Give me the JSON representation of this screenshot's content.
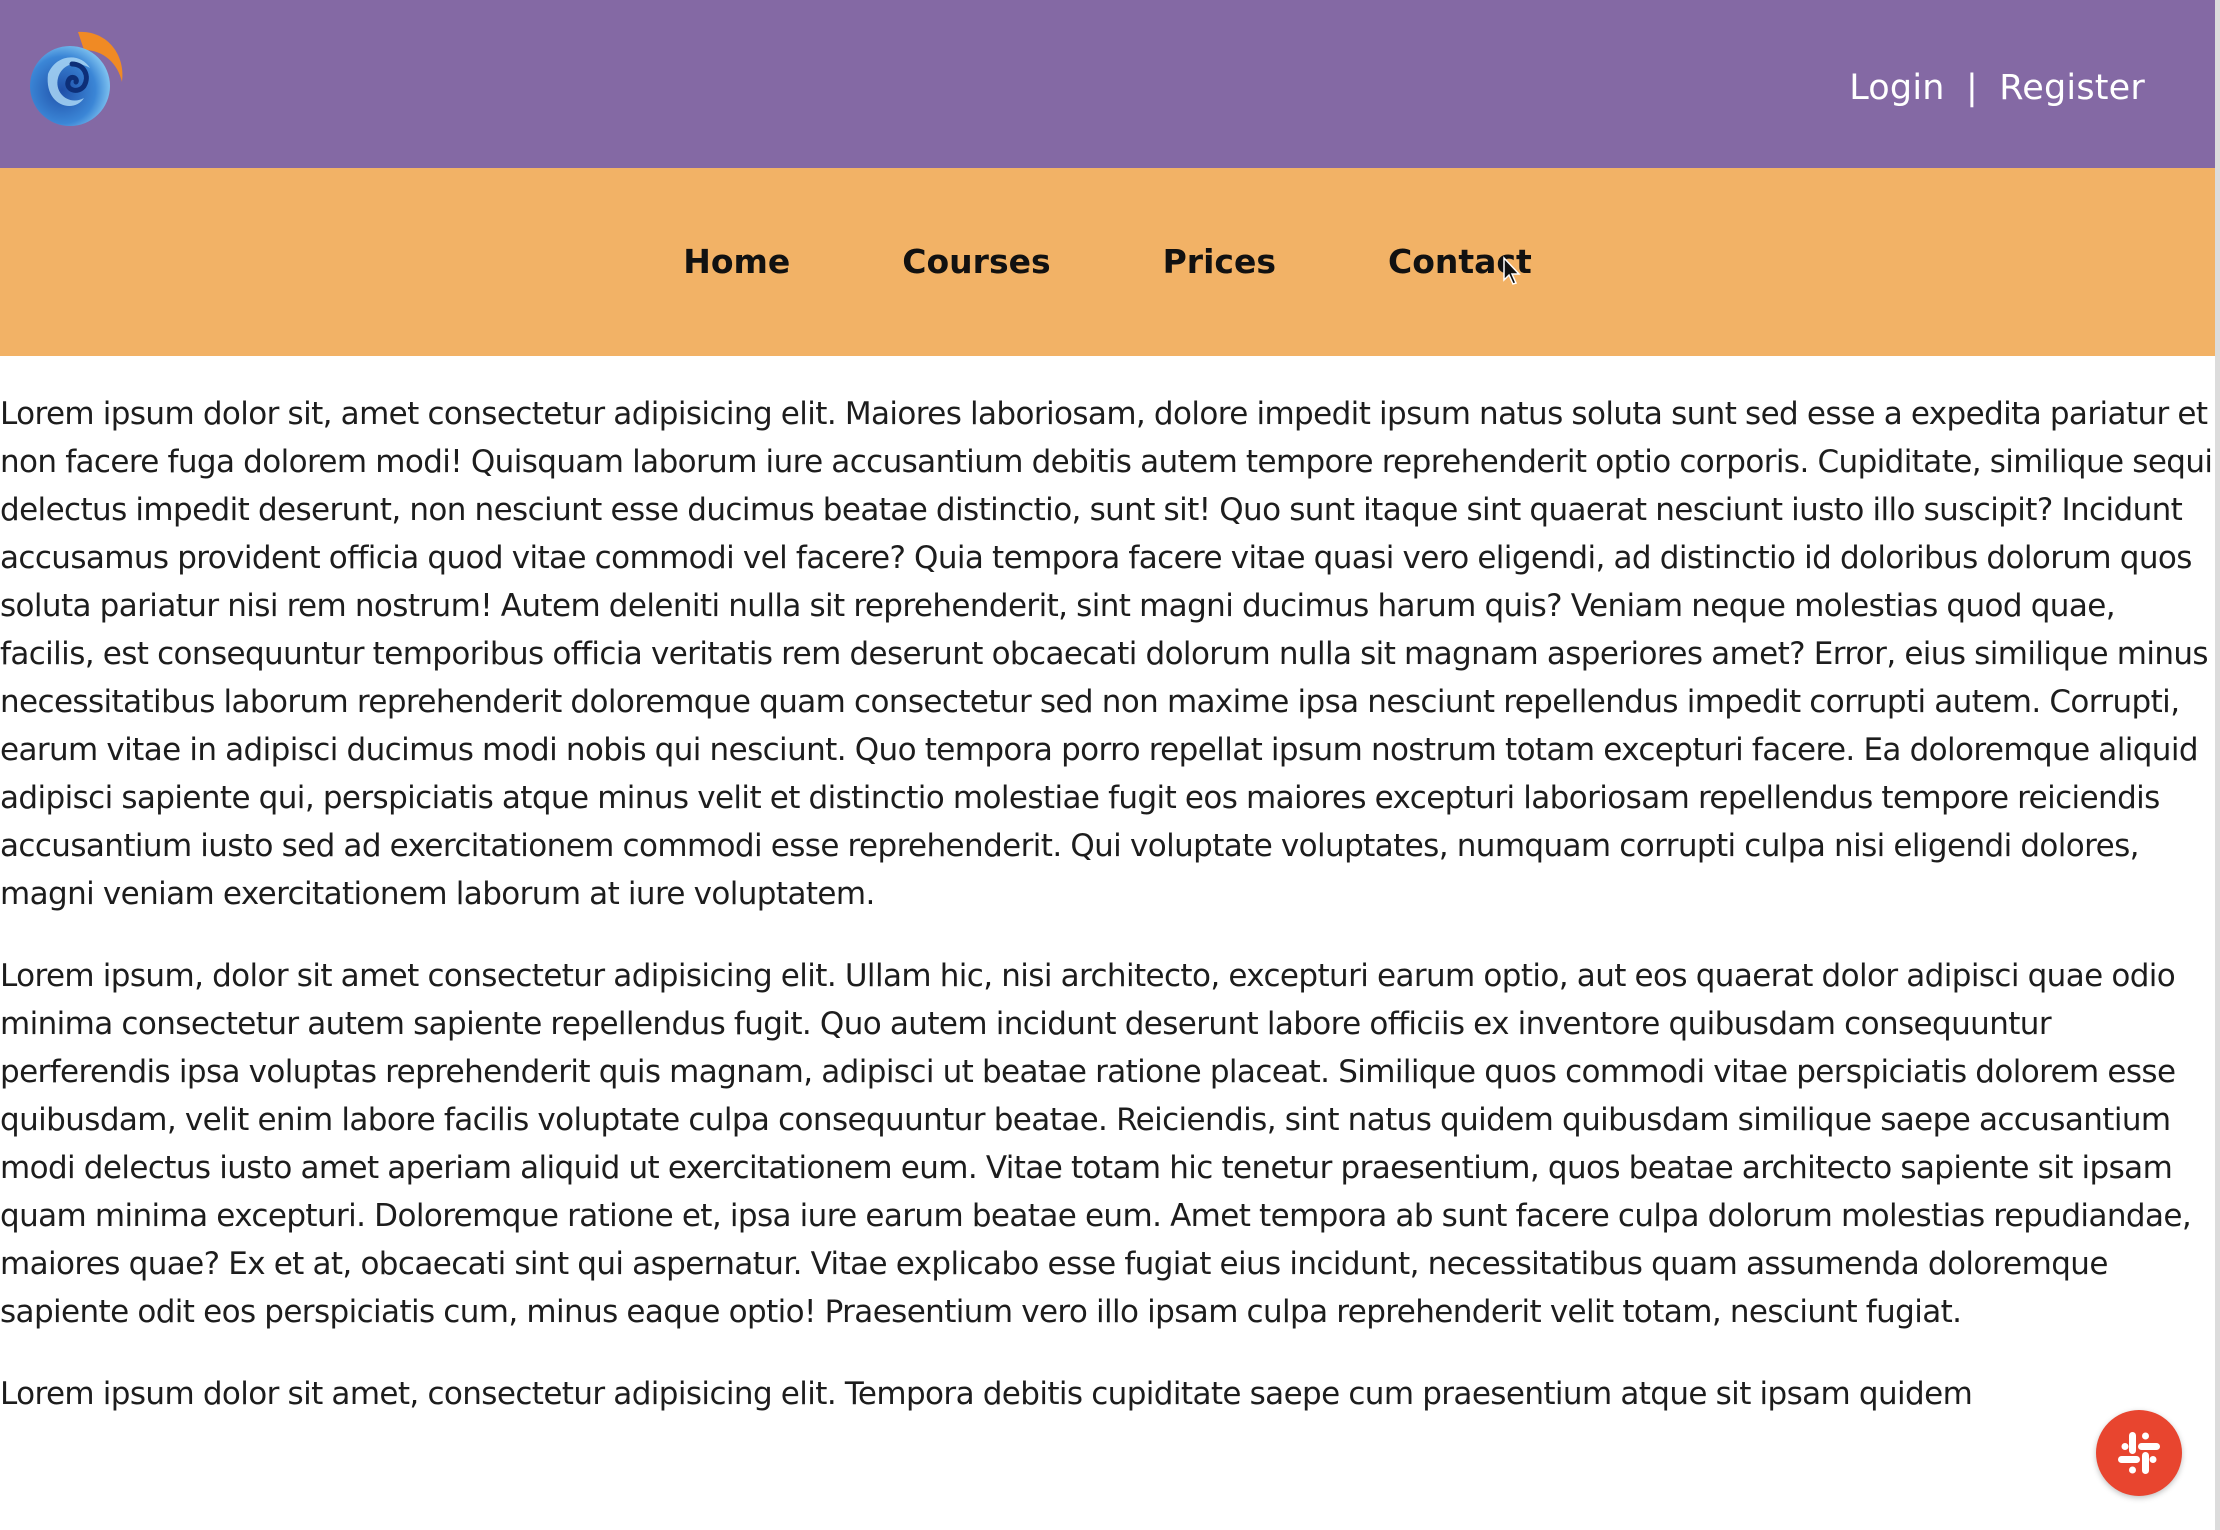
{
  "header": {
    "login_label": "Login",
    "separator": "|",
    "register_label": "Register",
    "logo_icon": "swirl-logo-icon",
    "colors": {
      "top_bar": "#8469a4",
      "nav_bar": "#f2b266",
      "chat_button": "#e8452f"
    }
  },
  "nav": {
    "items": [
      {
        "label": "Home"
      },
      {
        "label": "Courses"
      },
      {
        "label": "Prices"
      },
      {
        "label": "Contact"
      }
    ]
  },
  "content": {
    "paragraphs": [
      "Lorem ipsum dolor sit, amet consectetur adipisicing elit. Maiores laboriosam, dolore impedit ipsum natus soluta sunt sed esse a expedita pariatur et non facere fuga dolorem modi! Quisquam laborum iure accusantium debitis autem tempore reprehenderit optio corporis. Cupiditate, similique sequi delectus impedit deserunt, non nesciunt esse ducimus beatae distinctio, sunt sit! Quo sunt itaque sint quaerat nesciunt iusto illo suscipit? Incidunt accusamus provident officia quod vitae commodi vel facere? Quia tempora facere vitae quasi vero eligendi, ad distinctio id doloribus dolorum quos soluta pariatur nisi rem nostrum! Autem deleniti nulla sit reprehenderit, sint magni ducimus harum quis? Veniam neque molestias quod quae, facilis, est consequuntur temporibus officia veritatis rem deserunt obcaecati dolorum nulla sit magnam asperiores amet? Error, eius similique minus necessitatibus laborum reprehenderit doloremque quam consectetur sed non maxime ipsa nesciunt repellendus impedit corrupti autem. Corrupti, earum vitae in adipisci ducimus modi nobis qui nesciunt. Quo tempora porro repellat ipsum nostrum totam excepturi facere. Ea doloremque aliquid adipisci sapiente qui, perspiciatis atque minus velit et distinctio molestiae fugit eos maiores excepturi laboriosam repellendus tempore reiciendis accusantium iusto sed ad exercitationem commodi esse reprehenderit. Qui voluptate voluptates, numquam corrupti culpa nisi eligendi dolores, magni veniam exercitationem laborum at iure voluptatem.",
      "Lorem ipsum, dolor sit amet consectetur adipisicing elit. Ullam hic, nisi architecto, excepturi earum optio, aut eos quaerat dolor adipisci quae odio minima consectetur autem sapiente repellendus fugit. Quo autem incidunt deserunt labore officiis ex inventore quibusdam consequuntur perferendis ipsa voluptas reprehenderit quis magnam, adipisci ut beatae ratione placeat. Similique quos commodi vitae perspiciatis dolorem esse quibusdam, velit enim labore facilis voluptate culpa consequuntur beatae. Reiciendis, sint natus quidem quibusdam similique saepe accusantium modi delectus iusto amet aperiam aliquid ut exercitationem eum. Vitae totam hic tenetur praesentium, quos beatae architecto sapiente sit ipsam quam minima excepturi. Doloremque ratione et, ipsa iure earum beatae eum. Amet tempora ab sunt facere culpa dolorum molestias repudiandae, maiores quae? Ex et at, obcaecati sint qui aspernatur. Vitae explicabo esse fugiat eius incidunt, necessitatibus quam assumenda doloremque sapiente odit eos perspiciatis cum, minus eaque optio! Praesentium vero illo ipsam culpa reprehenderit velit totam, nesciunt fugiat.",
      "Lorem ipsum dolor sit amet, consectetur adipisicing elit. Tempora debitis cupiditate saepe cum praesentium atque sit ipsam quidem"
    ]
  },
  "widgets": {
    "chat_icon": "slack-icon",
    "cursor_icon": "mouse-pointer-icon"
  }
}
